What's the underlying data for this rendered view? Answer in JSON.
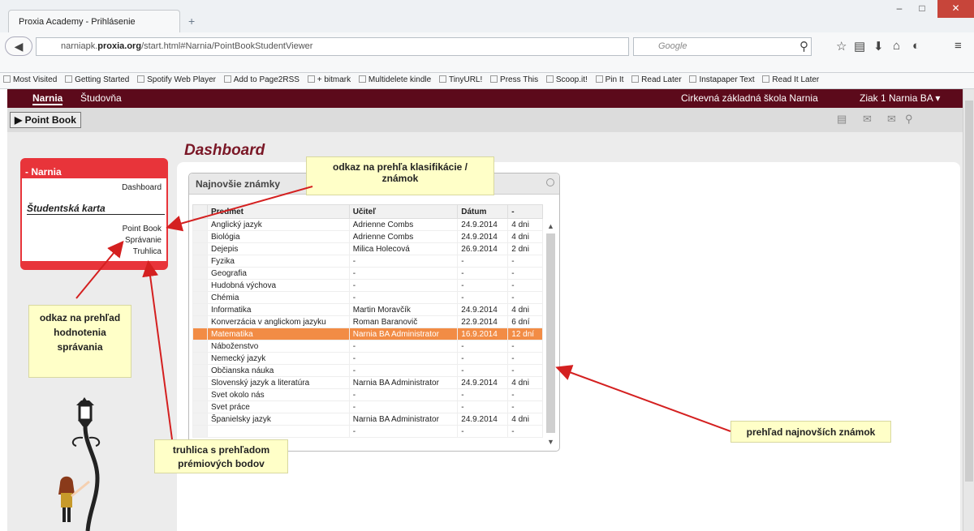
{
  "browser": {
    "tab_title": "Proxia Academy - Prihlásenie",
    "url_domain": "narniapk.proxia.org",
    "url_prefix": "narniapk.",
    "url_host": "proxia.org",
    "url_path": "/start.html#Narnia/PointBookStudentViewer",
    "search_placeholder": "Google",
    "new_tab": "+",
    "window_min": "–",
    "window_max": "□",
    "window_close": "✕"
  },
  "bookmarks": [
    "Most Visited",
    "Getting Started",
    "Spotify Web Player",
    "Add to Page2RSS",
    "+ bitmark",
    "Multidelete kindle",
    "TinyURL!",
    "Press This",
    "Scoop.it!",
    "Pin It",
    "Read Later",
    "Instapaper Text",
    "Read It Later"
  ],
  "appbar": {
    "nav_narnia": "Narnia",
    "nav_studovna": "Študovňa",
    "school": "Cirkevná základná škola Narnia",
    "user": "Ziak 1 Narnia BA ▾"
  },
  "subbar": {
    "pointbook_button": "▶ Point Book"
  },
  "sidebar": {
    "header": "- Narnia",
    "dashboard": "Dashboard",
    "section": "Študentská karta",
    "items": [
      "Point Book",
      "Správanie",
      "Truhlica"
    ]
  },
  "dashboard_title": "Dashboard",
  "widget": {
    "title": "Najnovšie známky",
    "columns": [
      "Predmet",
      "Učiteľ",
      "Dátum",
      "-"
    ],
    "rows": [
      [
        "Anglický jazyk",
        "Adrienne Combs",
        "24.9.2014",
        "4 dni"
      ],
      [
        "Biológia",
        "Adrienne Combs",
        "24.9.2014",
        "4 dni"
      ],
      [
        "Dejepis",
        "Milica Holecová",
        "26.9.2014",
        "2 dni"
      ],
      [
        "Fyzika",
        "-",
        "-",
        "-"
      ],
      [
        "Geografia",
        "-",
        "-",
        "-"
      ],
      [
        "Hudobná výchova",
        "-",
        "-",
        "-"
      ],
      [
        "Chémia",
        "-",
        "-",
        "-"
      ],
      [
        "Informatika",
        "Martin Moravčík",
        "24.9.2014",
        "4 dni"
      ],
      [
        "Konverzácia v anglickom jazyku",
        "Roman Baranovič",
        "22.9.2014",
        "6 dní"
      ],
      [
        "Matematika",
        "Narnia BA Administrator",
        "16.9.2014",
        "12 dní"
      ],
      [
        "Náboženstvo",
        "-",
        "-",
        "-"
      ],
      [
        "Nemecký jazyk",
        "-",
        "-",
        "-"
      ],
      [
        "Občianska náuka",
        "-",
        "-",
        "-"
      ],
      [
        "Slovenský jazyk a literatúra",
        "Narnia BA Administrator",
        "24.9.2014",
        "4 dni"
      ],
      [
        "Svet okolo nás",
        "-",
        "-",
        "-"
      ],
      [
        "Svet práce",
        "-",
        "-",
        "-"
      ],
      [
        "Španielsky jazyk",
        "Narnia BA Administrator",
        "24.9.2014",
        "4 dni"
      ],
      [
        "",
        "-",
        "-",
        "-"
      ]
    ],
    "highlighted_row": 9
  },
  "callouts": {
    "klasifikacia": "odkaz na prehľa klasifikácie / známok",
    "spravanie": "odkaz na prehľad hodnotenia správania",
    "truhlica": "truhlica s prehľadom prémiových bodov",
    "najnovsie": "prehľad najnovších známok"
  },
  "colors": {
    "accent": "#e8343a",
    "appbar": "#5c0a1b",
    "highlight": "#f28c45",
    "callout": "#ffffc8"
  }
}
